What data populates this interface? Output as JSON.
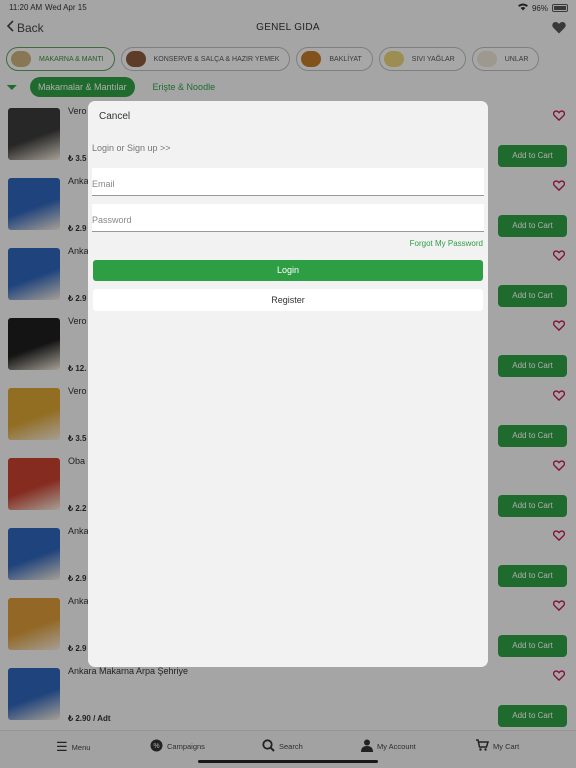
{
  "status_bar": {
    "time": "11:20 AM",
    "date": "Wed Apr 15",
    "battery": "96%"
  },
  "nav": {
    "back_label": "Back",
    "title": "GENEL GIDA"
  },
  "categories": [
    {
      "label": "MAKARNA & MANTI"
    },
    {
      "label": "KONSERVE & SALÇA & HAZIR YEMEK"
    },
    {
      "label": "BAKLİYAT"
    },
    {
      "label": "SIVI YAĞLAR"
    },
    {
      "label": "UNLAR"
    }
  ],
  "subcategories": [
    {
      "label": "Makarnalar & Mantılar"
    },
    {
      "label": "Erişte & Noodle"
    }
  ],
  "products": [
    {
      "name": "Vero",
      "price": "₺ 3.5",
      "cart_label": "Add to Cart",
      "img_color": "#3a3a3a"
    },
    {
      "name": "Anka",
      "price": "₺ 2.9",
      "cart_label": "Add to Cart",
      "img_color": "#2f64b8"
    },
    {
      "name": "Anka",
      "price": "₺ 2.9",
      "cart_label": "Add to Cart",
      "img_color": "#2f64b8"
    },
    {
      "name": "Vero",
      "price": "₺ 12.",
      "cart_label": "Add to Cart",
      "img_color": "#1e1e1e"
    },
    {
      "name": "Vero",
      "price": "₺ 3.5",
      "cart_label": "Add to Cart",
      "img_color": "#d8a234"
    },
    {
      "name": "Oba",
      "price": "₺ 2.2",
      "cart_label": "Add to Cart",
      "img_color": "#c6402f"
    },
    {
      "name": "Anka",
      "price": "₺ 2.9",
      "cart_label": "Add to Cart",
      "img_color": "#2f64b8"
    },
    {
      "name": "Anka",
      "price": "₺ 2.9",
      "cart_label": "Add to Cart",
      "img_color": "#d99a3a"
    },
    {
      "name": "Ankara Makarna Arpa Şehriye",
      "price": "₺ 2.90 / Adt",
      "cart_label": "Add to Cart",
      "img_color": "#2f64b8"
    }
  ],
  "tabbar": {
    "menu": "Menu",
    "campaigns": "Campaigns",
    "search": "Search",
    "account": "My Account",
    "cart": "My Cart"
  },
  "modal": {
    "cancel_label": "Cancel",
    "hint": "Login or Sign up >>",
    "email_placeholder": "Email",
    "password_placeholder": "Password",
    "forgot_label": "Forgot My Password",
    "login_label": "Login",
    "register_label": "Register"
  },
  "colors": {
    "accent": "#2e9e44",
    "heart": "#c2185b"
  }
}
